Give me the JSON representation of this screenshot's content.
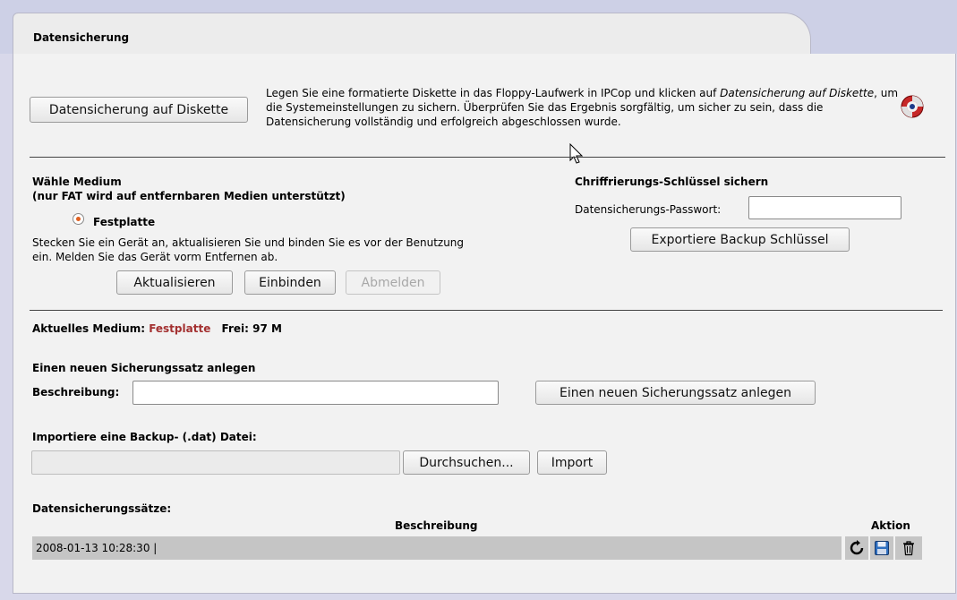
{
  "tab": {
    "title": "Datensicherung"
  },
  "floppy": {
    "button": "Datensicherung auf Diskette",
    "desc_1": "Legen Sie eine formatierte Diskette in das Floppy-Laufwerk in IPCop und klicken auf",
    "desc_italic": "Datensicherung auf Diskette",
    "desc_2": ", um die Systemeinstellungen zu sichern. Überprüfen Sie das Ergebnis sorgfältig, um sicher zu sein, dass die Datensicherung vollständig und erfolgreich abgeschlossen wurde.",
    "help_icon": "lifebuoy-help-icon"
  },
  "medium": {
    "title": "Wähle Medium",
    "subtitle": "(nur FAT wird auf entfernbaren Medien unterstützt)",
    "radio_label": "Festplatte",
    "hint_1": "Stecken Sie ein Gerät an, aktualisieren Sie und binden Sie es vor der Benutzung",
    "hint_2": "ein. Melden Sie das Gerät vorm Entfernen ab.",
    "btn_refresh": "Aktualisieren",
    "btn_mount": "Einbinden",
    "btn_unmount": "Abmelden"
  },
  "encryption": {
    "title": "Chriffrierungs-Schlüssel sichern",
    "password_label": "Datensicherungs-Passwort:",
    "password_value": "",
    "export_button": "Exportiere Backup Schlüssel"
  },
  "current": {
    "label": "Aktuelles Medium:",
    "medium": "Festplatte",
    "free": "Frei: 97 M",
    "accent_color": "#a33030"
  },
  "newset": {
    "title": "Einen neuen Sicherungssatz anlegen",
    "desc_label": "Beschreibung:",
    "desc_value": "",
    "button": "Einen neuen Sicherungssatz anlegen"
  },
  "import": {
    "title": "Importiere eine Backup- (.dat) Datei:",
    "file_value": "",
    "browse_button": "Durchsuchen...",
    "import_button": "Import"
  },
  "sets": {
    "title": "Datensicherungssätze:",
    "col_desc": "Beschreibung",
    "col_action": "Aktion",
    "rows": [
      {
        "desc": "2008-01-13 10:28:30 |",
        "actions": [
          "restore-icon",
          "save-floppy-icon",
          "trash-icon"
        ]
      }
    ]
  }
}
